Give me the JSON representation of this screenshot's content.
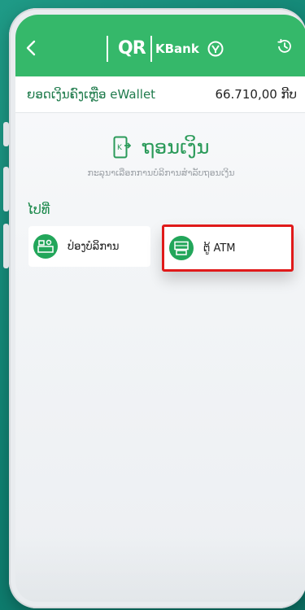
{
  "header": {
    "brand_qr": "QR",
    "brand_name": "KBank"
  },
  "balance": {
    "label": "ຍອດເງິນຄົງເຫຼືອ eWallet",
    "amount": "66.710,00 ກີບ"
  },
  "page": {
    "title": "ຖອນເງິນ",
    "subtitle": "ກະລຸນາເລືອກການບໍລິການສຳລັບຖອນເງິນ",
    "goto_label": "ໄປທີ່"
  },
  "options": [
    {
      "label": "ປ່ອງບໍລິການ",
      "icon": "service-counter-icon"
    },
    {
      "label": "ຕູ້ ATM",
      "icon": "atm-icon"
    }
  ],
  "colors": {
    "header_green": "#35b86a",
    "accent_green": "#22a65a",
    "highlight_red": "#e01a1a"
  }
}
